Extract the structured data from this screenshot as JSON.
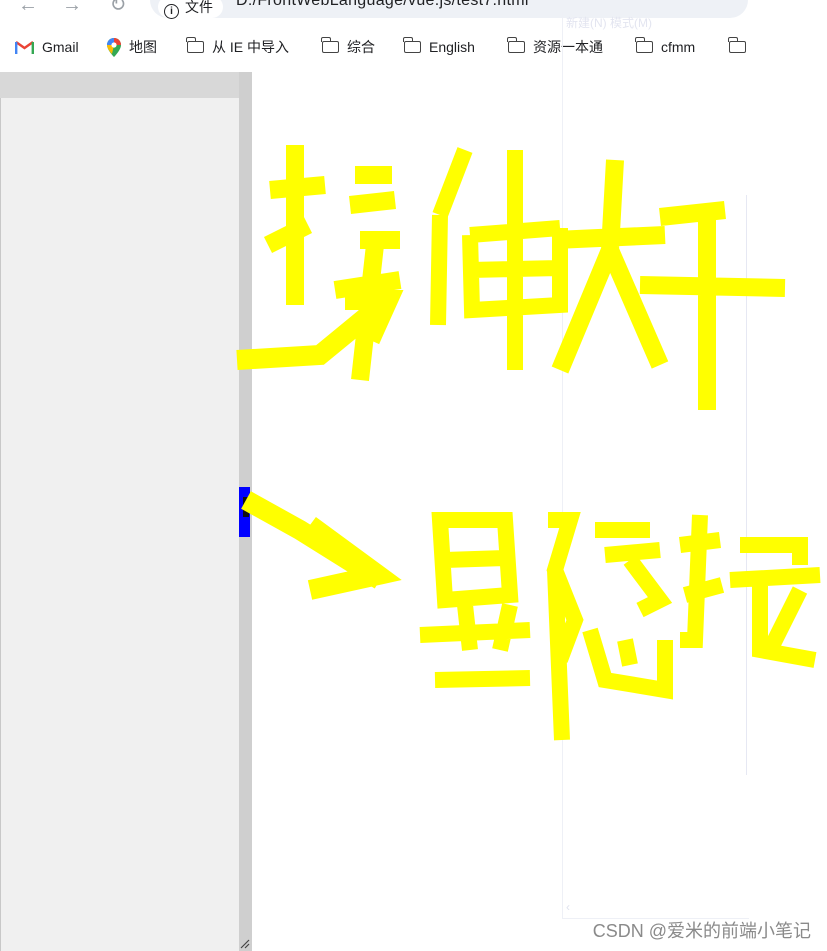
{
  "browser": {
    "address_chip": "文件",
    "url": "D:/FrontWebLanguage/vue.js/test7.html",
    "bookmarks": [
      {
        "label": "Gmail",
        "icon": "gmail-icon"
      },
      {
        "label": "地图",
        "icon": "maps-icon"
      },
      {
        "label": "从 IE 中导入",
        "icon": "folder-icon"
      },
      {
        "label": "综合",
        "icon": "folder-icon"
      },
      {
        "label": "English",
        "icon": "folder-icon"
      },
      {
        "label": "资源一本通",
        "icon": "folder-icon"
      },
      {
        "label": "cfmm",
        "icon": "folder-icon"
      },
      {
        "label": "",
        "icon": "folder-icon"
      }
    ]
  },
  "overlay": {
    "faint_text": "新建(N)  模式(M)"
  },
  "annotations": {
    "top": "拉伸大干",
    "bottom": "显隐按"
  },
  "watermark": "CSDN @爱米的前端小笔记",
  "colors": {
    "annotation": "#ffff00",
    "toggle": "#0000ff",
    "sidebar": "#f0f0f0"
  }
}
